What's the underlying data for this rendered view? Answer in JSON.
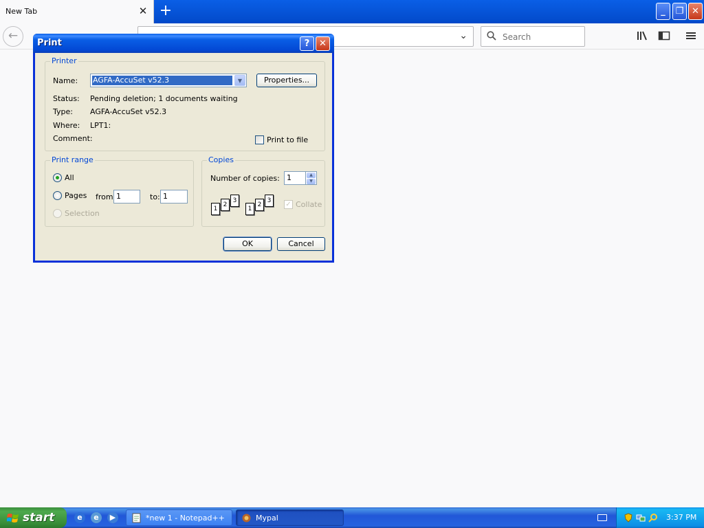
{
  "browser": {
    "tab_title": "New Tab",
    "tab_close": "✕",
    "new_tab": "+",
    "search_placeholder": "Search"
  },
  "print_dialog": {
    "title": "Print",
    "help": "?",
    "close": "✕",
    "printer_group": "Printer",
    "name_label": "Name:",
    "name_value": "AGFA-AccuSet v52.3",
    "properties_button": "Properties...",
    "status_label": "Status:",
    "status_value": "Pending deletion; 1 documents waiting",
    "type_label": "Type:",
    "type_value": "AGFA-AccuSet v52.3",
    "where_label": "Where:",
    "where_value": "LPT1:",
    "comment_label": "Comment:",
    "print_to_file": "Print to file",
    "print_range_group": "Print range",
    "all_label": "All",
    "pages_label": "Pages",
    "from_label": "from:",
    "from_value": "1",
    "to_label": "to:",
    "to_value": "1",
    "selection_label": "Selection",
    "copies_group": "Copies",
    "copies_label": "Number of copies:",
    "copies_value": "1",
    "collate_label": "Collate",
    "ok_button": "OK",
    "cancel_button": "Cancel"
  },
  "taskbar": {
    "start": "start",
    "tasks": [
      {
        "label": "*new 1 - Notepad++"
      },
      {
        "label": "Mypal"
      }
    ],
    "clock": "3:37 PM"
  },
  "colors": {
    "xp_blue": "#0a5fe6",
    "dialog_bg": "#ece9d8",
    "selection": "#316ac5",
    "group_legend": "#0046d5"
  }
}
